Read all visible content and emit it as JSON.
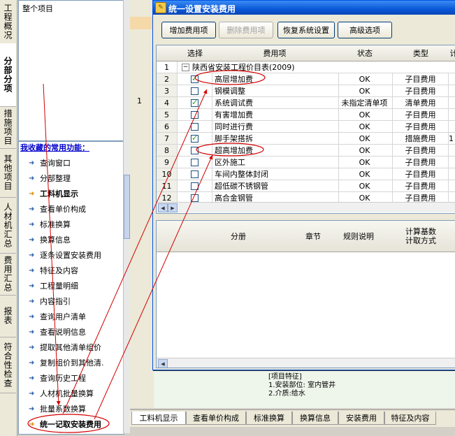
{
  "left_tabs": [
    {
      "label": "工程概况",
      "active": false
    },
    {
      "label": "分部分项",
      "active": true
    },
    {
      "label": "措施项目",
      "active": false
    },
    {
      "label": "其他项目",
      "active": false
    },
    {
      "label": "人材机汇总",
      "active": false
    },
    {
      "label": "费用汇总",
      "active": false
    },
    {
      "label": "报表",
      "active": false
    },
    {
      "label": "符合性检查",
      "active": false
    }
  ],
  "tree": {
    "root": "整个项目"
  },
  "functions": {
    "header": "我收藏的常用功能：",
    "items": [
      "查询窗口",
      "分部整理",
      "工料机显示",
      "查看单价构成",
      "标准换算",
      "换算信息",
      "逐条设置安装费用",
      "特征及内容",
      "工程量明细",
      "内容指引",
      "查询用户清单",
      "查看说明信息",
      "提取其他清单组价",
      "复制组价到其他清.",
      "查询历史工程",
      "人材机批量换算",
      "批量系数换算",
      "统一记取安装费用"
    ]
  },
  "background": {
    "row_number": "1",
    "bottom_text": [
      "[项目特征]",
      "1.安装部位: 室内管井",
      "2.介质:给水"
    ]
  },
  "bottom_tabs": [
    "工料机显示",
    "查看单价构成",
    "标准换算",
    "换算信息",
    "安装费用",
    "特征及内容"
  ],
  "dialog": {
    "title": "统一设置安装费用",
    "buttons": {
      "add": "增加费用项",
      "delete": "删除费用项",
      "restore": "恢复系统设置",
      "advanced": "高级选项"
    },
    "grid": {
      "headers": {
        "select": "选择",
        "item": "费用项",
        "status": "状态",
        "type": "类型",
        "extra": "计"
      },
      "group": {
        "num": "1",
        "toggle": "−",
        "label": "陕西省安装工程价目表(2009)"
      },
      "rows": [
        {
          "num": "2",
          "checked": true,
          "item": "高层增加费",
          "status": "OK",
          "type": "子目费用"
        },
        {
          "num": "3",
          "checked": false,
          "item": "钢模调整",
          "status": "OK",
          "type": "子目费用"
        },
        {
          "num": "4",
          "checked": true,
          "item": "系统调试费",
          "status": "未指定清单项",
          "type": "清单费用"
        },
        {
          "num": "5",
          "checked": false,
          "item": "有害增加费",
          "status": "OK",
          "type": "子目费用"
        },
        {
          "num": "6",
          "checked": false,
          "item": "同时进行费",
          "status": "OK",
          "type": "子目费用"
        },
        {
          "num": "7",
          "checked": true,
          "item": "脚手架搭拆",
          "status": "OK",
          "type": "措施费用",
          "extra": "1"
        },
        {
          "num": "8",
          "checked": false,
          "item": "超高增加费",
          "status": "OK",
          "type": "子目费用"
        },
        {
          "num": "9",
          "checked": false,
          "item": "区外施工",
          "status": "OK",
          "type": "子目费用"
        },
        {
          "num": "10",
          "checked": false,
          "item": "车间内整体封闭",
          "status": "OK",
          "type": "子目费用"
        },
        {
          "num": "11",
          "checked": false,
          "item": "超低碳不锈钢管",
          "status": "OK",
          "type": "子目费用"
        },
        {
          "num": "12",
          "checked": false,
          "item": "高合金钢管",
          "status": "OK",
          "type": "子目费用"
        }
      ]
    },
    "grid2": {
      "headers": [
        "分册",
        "章节",
        "规则说明",
        "计算基数\n计取方式"
      ]
    }
  },
  "colors": {
    "annotation": "#d40000",
    "title_bar": "#0a58d8"
  }
}
